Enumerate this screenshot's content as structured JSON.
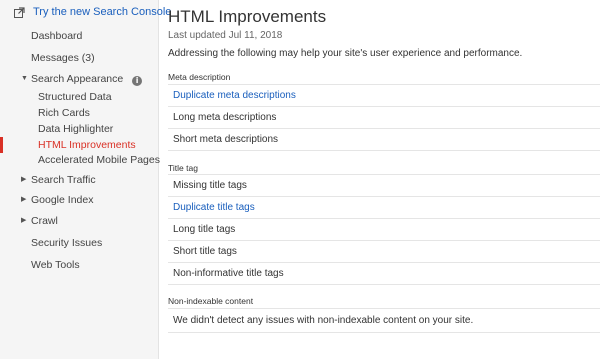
{
  "sidebar": {
    "promo_label": "Try the new Search Console",
    "items": [
      {
        "label": "Dashboard"
      },
      {
        "label": "Messages (3)"
      },
      {
        "label": "Search Appearance"
      },
      {
        "label": "Structured Data"
      },
      {
        "label": "Rich Cards"
      },
      {
        "label": "Data Highlighter"
      },
      {
        "label": "HTML Improvements"
      },
      {
        "label": "Accelerated Mobile Pages"
      },
      {
        "label": "Search Traffic"
      },
      {
        "label": "Google Index"
      },
      {
        "label": "Crawl"
      },
      {
        "label": "Security Issues"
      },
      {
        "label": "Web Tools"
      }
    ],
    "info_glyph": "i",
    "caret_down": "▼",
    "caret_right": "▶"
  },
  "main": {
    "title": "HTML Improvements",
    "last_updated": "Last updated Jul 11, 2018",
    "intro": "Addressing the following may help your site's user experience and performance.",
    "sections": [
      {
        "heading": "Meta description",
        "rows": [
          {
            "label": "Duplicate meta descriptions"
          },
          {
            "label": "Long meta descriptions"
          },
          {
            "label": "Short meta descriptions"
          }
        ]
      },
      {
        "heading": "Title tag",
        "rows": [
          {
            "label": "Missing title tags"
          },
          {
            "label": "Duplicate title tags"
          },
          {
            "label": "Long title tags"
          },
          {
            "label": "Short title tags"
          },
          {
            "label": "Non-informative title tags"
          }
        ]
      },
      {
        "heading": "Non-indexable content",
        "rows": [
          {
            "label": "We didn't detect any issues with non-indexable content on your site."
          }
        ]
      }
    ]
  },
  "colors": {
    "accent_link": "#1a5fbd",
    "active": "#d93025",
    "sidebar_bg": "#f5f5f5"
  }
}
